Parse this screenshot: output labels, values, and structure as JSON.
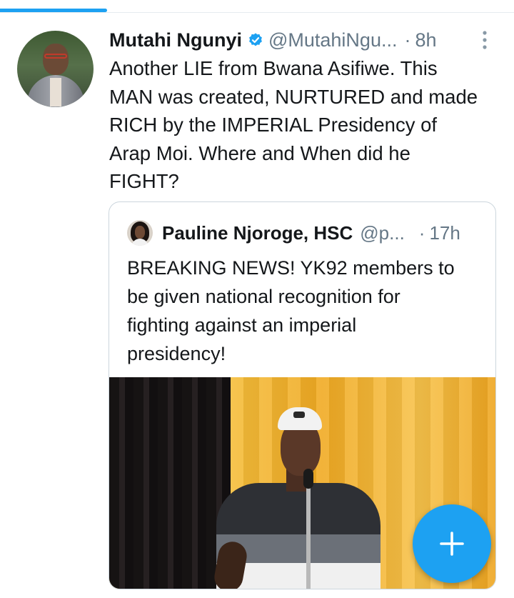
{
  "tweet": {
    "author_name": "Mutahi Ngunyi",
    "handle": "@MutahiNgu...",
    "separator": "·",
    "time": "8h",
    "text": "Another LIE from Bwana Asifiwe. This\nMAN was created, NURTURED and made\nRICH by the IMPERIAL Presidency of\nArap Moi. Where and When did he\nFIGHT?"
  },
  "quoted_tweet": {
    "author_name": "Pauline Njoroge, HSC",
    "handle": "@p...",
    "separator": "·",
    "time": "17h",
    "text": "BREAKING NEWS! YK92 members to\nbe given national recognition for\nfighting against an imperial\npresidency!"
  },
  "icons": {
    "verified": "verified-badge-icon",
    "more": "more-vertical-icon",
    "compose": "plus-icon"
  },
  "colors": {
    "accent": "#1da1f2",
    "text_primary": "#14171a",
    "text_secondary": "#657786",
    "border": "#ccd6dd"
  }
}
